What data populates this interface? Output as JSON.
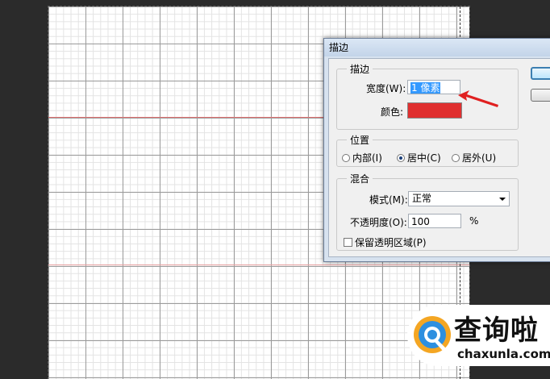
{
  "dialog": {
    "title": "描边",
    "stroke_group": {
      "title": "描边",
      "width_label": "宽度(W):",
      "width_value": "1 像素",
      "color_label": "颜色:",
      "color_value": "#e03030"
    },
    "position_group": {
      "title": "位置",
      "options": [
        {
          "label": "内部(I)",
          "selected": false
        },
        {
          "label": "居中(C)",
          "selected": true
        },
        {
          "label": "居外(U)",
          "selected": false
        }
      ]
    },
    "blend_group": {
      "title": "混合",
      "mode_label": "模式(M):",
      "mode_value": "正常",
      "opacity_label": "不透明度(O):",
      "opacity_value": "100",
      "opacity_unit": "%",
      "preserve_label": "保留透明区域(P)",
      "preserve_checked": false
    }
  },
  "watermark": {
    "title": "查询啦",
    "url": "chaxunla.com"
  },
  "colors": {
    "annotation_arrow": "#e02020",
    "guide": "#e07070",
    "workspace_bg": "#2b2b2b"
  }
}
